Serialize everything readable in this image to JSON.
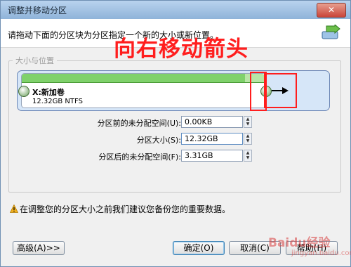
{
  "window": {
    "title": "调整并移动分区",
    "close_label": "✕"
  },
  "header": {
    "instruction": "请拖动下面的分区块为分区指定一个新的大小或新位置。"
  },
  "annotation": {
    "text": "向右移动箭头",
    "color": "#ff1e1e"
  },
  "group": {
    "label": "大小与位置"
  },
  "partition": {
    "name": "X:新加卷",
    "info": "12.32GB NTFS",
    "used_fraction": 0.92,
    "bar_color": "#7fd16b"
  },
  "fields": [
    {
      "label": "分区前的未分配空间(U):",
      "value": "0.00KB"
    },
    {
      "label": "分区大小(S):",
      "value": "12.32GB"
    },
    {
      "label": "分区后的未分配空间(F):",
      "value": "3.31GB"
    }
  ],
  "warning": {
    "text": "在调整您的分区大小之前我们建议您备份您的重要数据。"
  },
  "buttons": {
    "advanced": "高级(A)>>",
    "ok": "确定(O)",
    "cancel": "取消(C)",
    "help": "帮助(H)"
  },
  "watermark": {
    "text": "Baidu经验",
    "sub": "jingyan.baidu.com"
  }
}
